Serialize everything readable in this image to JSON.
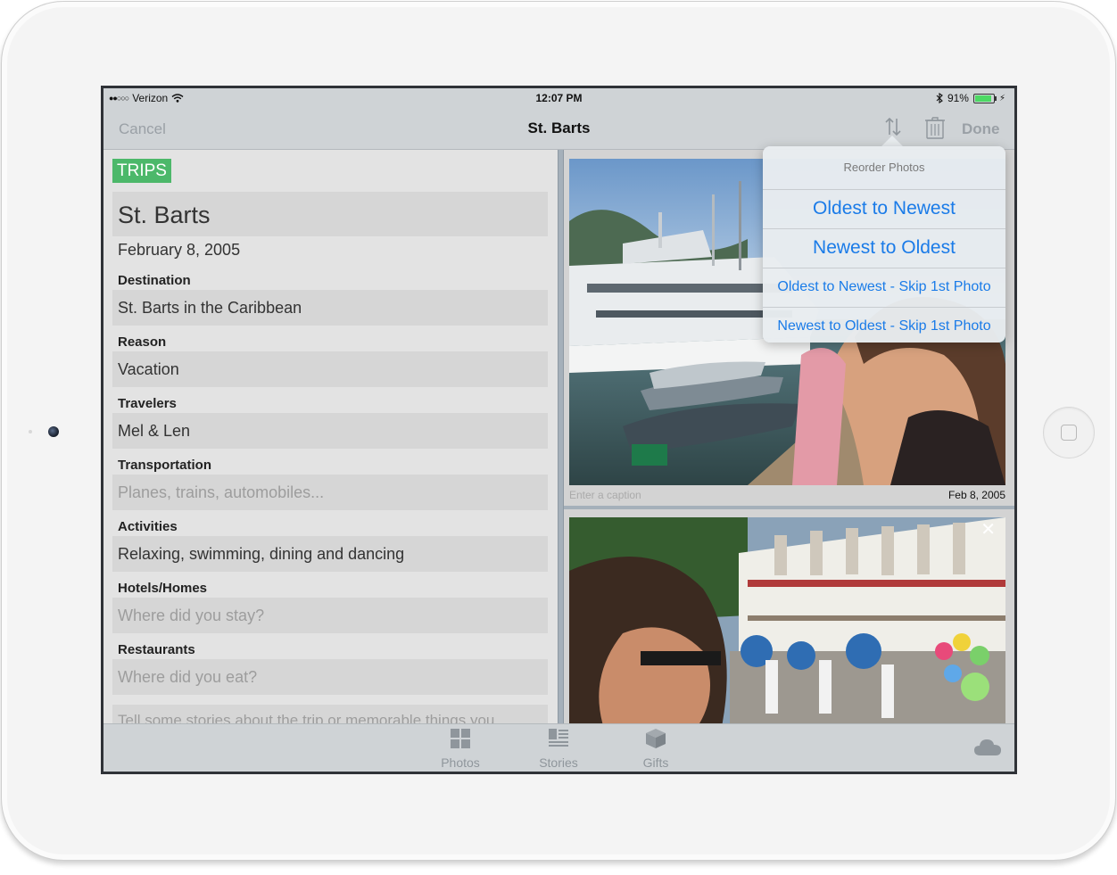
{
  "status_bar": {
    "carrier": "Verizon",
    "signal": "●●○○○",
    "time": "12:07 PM",
    "battery": "91%"
  },
  "nav": {
    "cancel": "Cancel",
    "title": "St. Barts",
    "done": "Done",
    "sort_icon": "sort-arrows-icon",
    "trash_icon": "trash-icon"
  },
  "form": {
    "badge": "TRIPS",
    "title": "St. Barts",
    "date": "February 8, 2005",
    "fields": [
      {
        "label": "Destination",
        "value": "St. Barts in the Caribbean",
        "placeholder": false
      },
      {
        "label": "Reason",
        "value": "Vacation",
        "placeholder": false
      },
      {
        "label": "Travelers",
        "value": "Mel & Len",
        "placeholder": false
      },
      {
        "label": "Transportation",
        "value": "Planes, trains, automobiles...",
        "placeholder": true
      },
      {
        "label": "Activities",
        "value": "Relaxing, swimming, dining and dancing",
        "placeholder": false
      },
      {
        "label": "Hotels/Homes",
        "value": "Where did you stay?",
        "placeholder": true
      },
      {
        "label": "Restaurants",
        "value": "Where did you eat?",
        "placeholder": true
      }
    ],
    "stories_placeholder": "Tell some stories about the trip or memorable things you"
  },
  "photos": {
    "caption_placeholder": "Enter a caption",
    "photo1_date": "Feb 8, 2005"
  },
  "popover": {
    "title": "Reorder Photos",
    "options": [
      "Oldest to Newest",
      "Newest to Oldest",
      "Oldest to Newest - Skip 1st Photo",
      "Newest to Oldest - Skip 1st Photo"
    ]
  },
  "toolbar": {
    "photos": "Photos",
    "stories": "Stories",
    "gifts": "Gifts"
  },
  "colors": {
    "accent_blue": "#1a7be8",
    "badge_green": "#4cb86a",
    "bar_gray": "#cfd3d6"
  }
}
